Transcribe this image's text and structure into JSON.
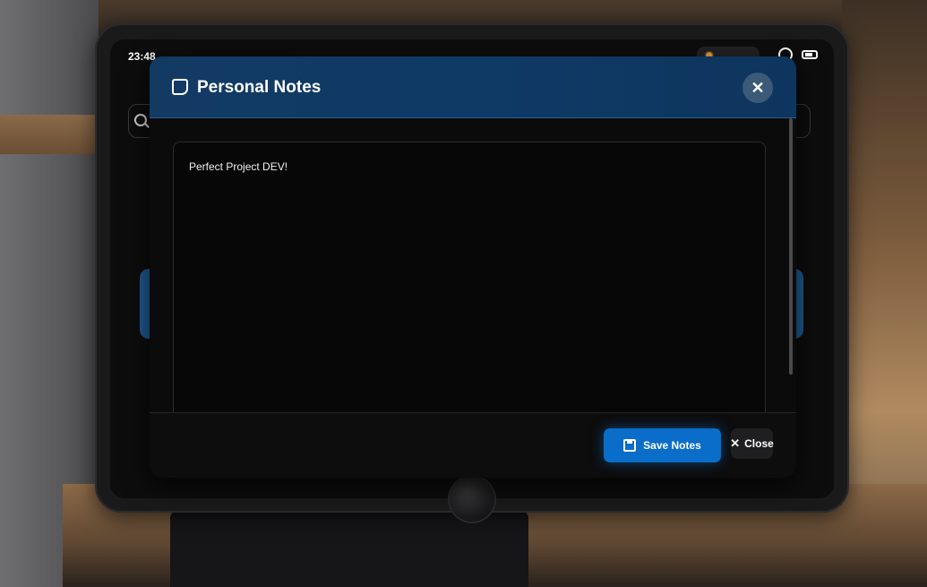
{
  "status_bar": {
    "time": "23:48",
    "weather_icon": "sun-icon",
    "icons": [
      "ring-icon",
      "battery-icon"
    ]
  },
  "search": {
    "icon": "search-icon"
  },
  "modal": {
    "title": "Personal Notes",
    "title_icon": "notes-icon",
    "close_icon": "close-icon",
    "notes_text": "Perfect Project DEV!",
    "buttons": {
      "save_label": "Save Notes",
      "save_icon": "save-icon",
      "close_label": "Close",
      "close_icon": "close-icon"
    }
  },
  "colors": {
    "header_bg": "#0f3a66",
    "primary_button": "#0a6dc9",
    "accent_weather": "#e8a23b"
  }
}
